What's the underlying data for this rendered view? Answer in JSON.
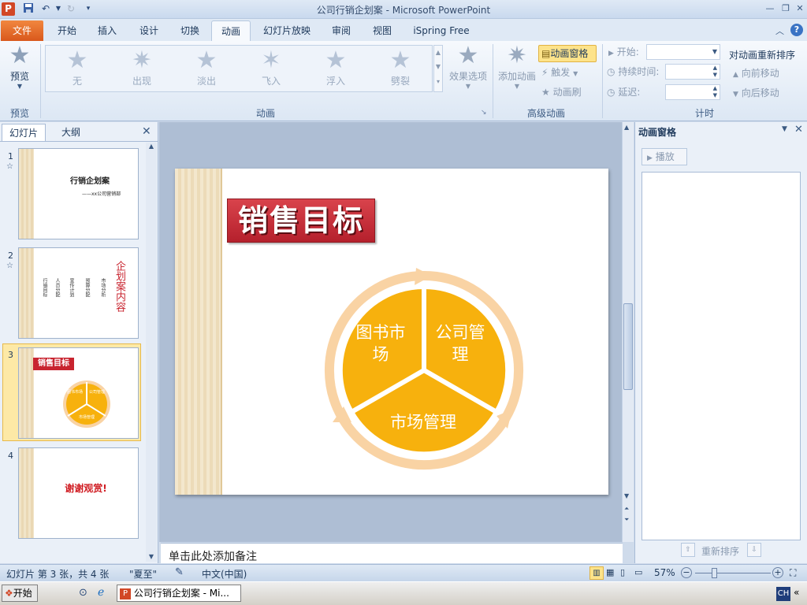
{
  "window": {
    "title": "公司行销企划案 - Microsoft PowerPoint"
  },
  "qat": {
    "app_icon": "P"
  },
  "tabs": [
    "文件",
    "开始",
    "插入",
    "设计",
    "切换",
    "动画",
    "幻灯片放映",
    "审阅",
    "视图",
    "iSpring Free"
  ],
  "ribbon": {
    "preview": {
      "label": "预览",
      "group": "预览"
    },
    "animation_group": "动画",
    "gallery": [
      "无",
      "出现",
      "淡出",
      "飞入",
      "浮入",
      "劈裂"
    ],
    "effect_options": "效果选项",
    "add_animation": "添加动画",
    "animation_pane": "动画窗格",
    "trigger": "触发",
    "animation_painter": "动画刷",
    "advanced_group": "高级动画",
    "start_label": "开始:",
    "duration_label": "持续时间:",
    "delay_label": "延迟:",
    "reorder_title": "对动画重新排序",
    "move_earlier": "向前移动",
    "move_later": "向后移动",
    "timing_group": "计时"
  },
  "slides_panel": {
    "tabs": [
      "幻灯片",
      "大纲"
    ],
    "slides": [
      {
        "num": "1",
        "title": "行销企划案",
        "subtitle": "——xx公司营销部"
      },
      {
        "num": "2",
        "title": "企划案内容",
        "items": [
          "行销目标",
          "人员分配",
          "宣传计划",
          "预算分配",
          "市场分析"
        ]
      },
      {
        "num": "3",
        "title": "销售目标",
        "segments": [
          "图书市场",
          "公司管理",
          "市场管理"
        ]
      },
      {
        "num": "4",
        "title": "谢谢观赏!"
      }
    ]
  },
  "slide": {
    "title": "销售目标",
    "segments": {
      "a": "图书市\n场",
      "b": "公司管\n理",
      "c": "市场管理"
    },
    "colors": {
      "segment": "#f7b10d",
      "ring": "#f9d3a4",
      "title_bg": "#c8242f"
    }
  },
  "notes": {
    "placeholder": "单击此处添加备注"
  },
  "anim_pane": {
    "title": "动画窗格",
    "play": "播放",
    "reorder": "重新排序"
  },
  "status": {
    "slide_info": "幻灯片 第 3 张，共 4 张",
    "theme": "\"夏至\"",
    "language": "中文(中国)",
    "zoom": "57%"
  },
  "taskbar": {
    "start": "开始",
    "task": "公司行销企划案 - Mi...",
    "ime": "CH"
  }
}
